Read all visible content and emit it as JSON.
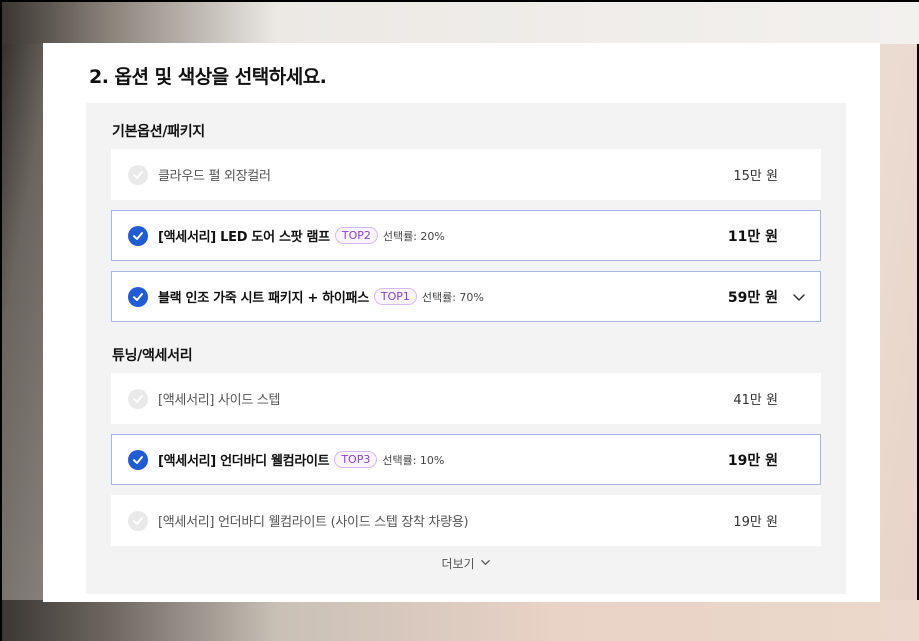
{
  "section": {
    "title": "2. 옵션 및 색상을 선택하세요."
  },
  "groups": [
    {
      "title": "기본옵션/패키지",
      "items": [
        {
          "label": "클라우드 펄 외장컬러",
          "price": "15만 원",
          "selected": false
        },
        {
          "label": "[액세서리] LED 도어 스팟 램프",
          "badge": "TOP2",
          "rate": "선택률: 20%",
          "price": "11만 원",
          "selected": true
        },
        {
          "label": "블랙 인조 가죽 시트 패키지 + 하이패스",
          "badge": "TOP1",
          "rate": "선택률: 70%",
          "price": "59만 원",
          "selected": true,
          "expandable": true
        }
      ]
    },
    {
      "title": "튜닝/액세서리",
      "items": [
        {
          "label": "[액세서리] 사이드 스텝",
          "price": "41만 원",
          "selected": false
        },
        {
          "label": "[액세서리] 언더바디 웰컴라이트",
          "badge": "TOP3",
          "rate": "선택률: 10%",
          "price": "19만 원",
          "selected": true
        },
        {
          "label": "[액세서리] 언더바디 웰컴라이트 (사이드 스텝 장착 차량용)",
          "price": "19만 원",
          "selected": false
        }
      ]
    }
  ],
  "more": {
    "label": "더보기",
    "icon": "chevron-down-icon"
  },
  "colors": {
    "accent": "#1f5cd6",
    "badge": "#8a3fd1",
    "selected_border": "#a9b4e0"
  }
}
